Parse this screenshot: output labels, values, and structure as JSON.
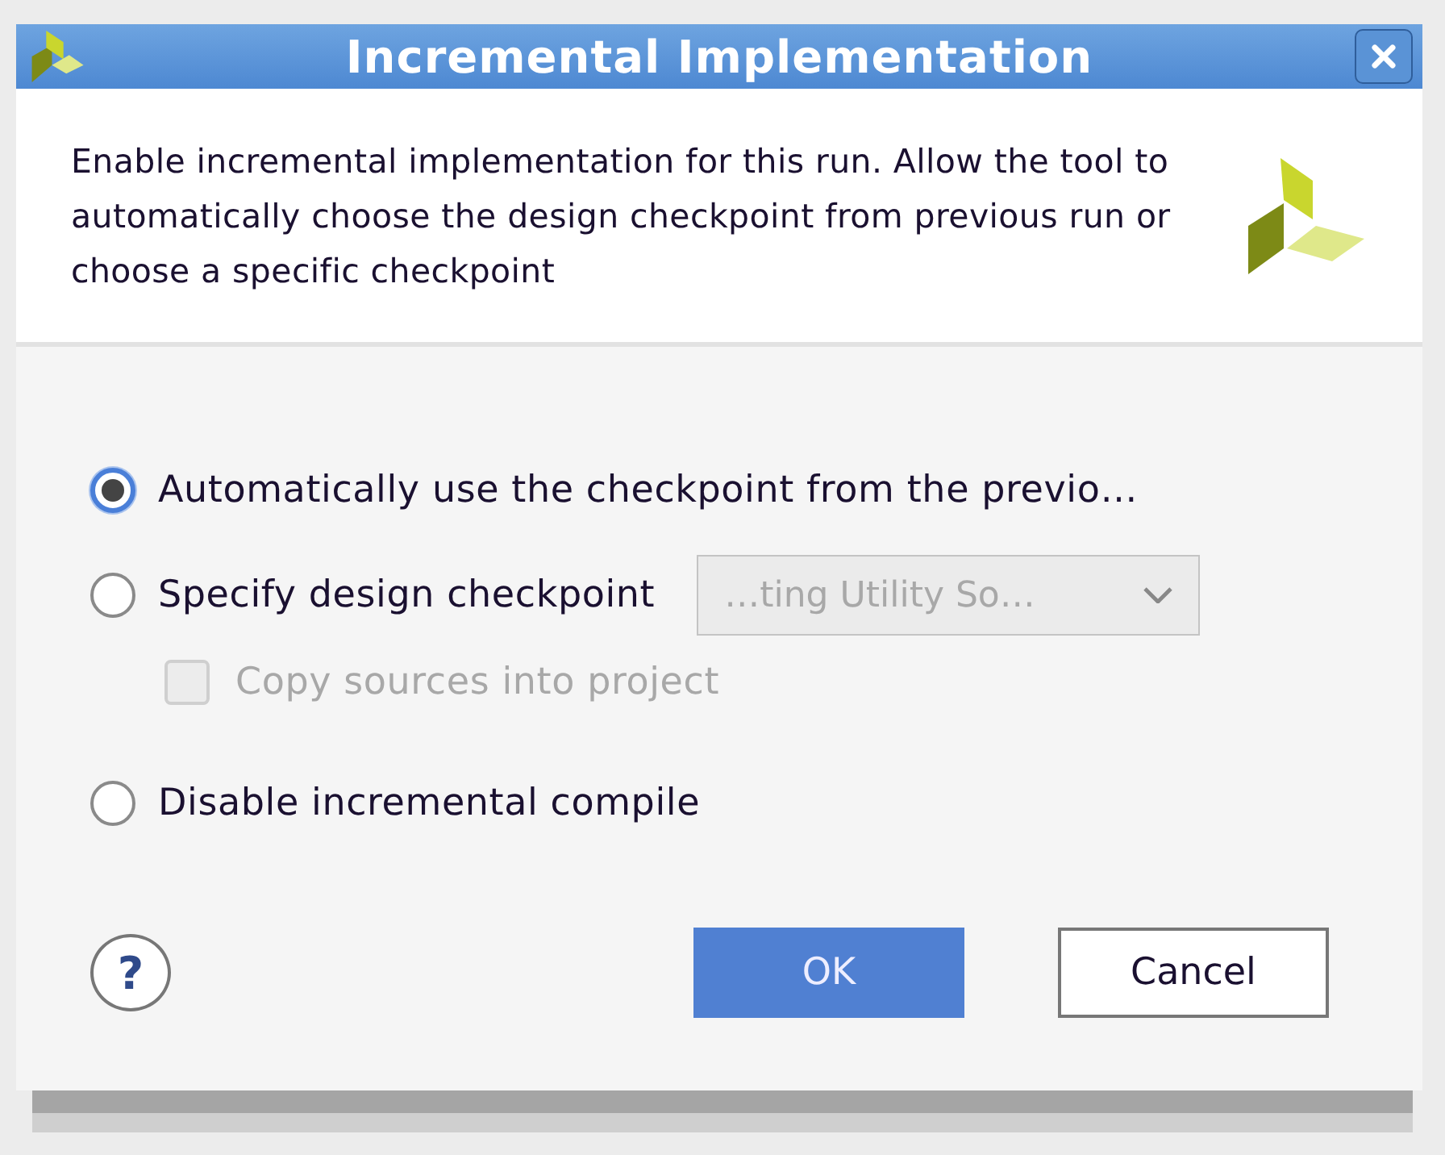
{
  "window": {
    "title": "Incremental Implementation"
  },
  "description": "Enable incremental implementation for this run. Allow the tool to automatically choose the design checkpoint from previous run or choose a specific checkpoint",
  "options": [
    {
      "kind": "radio",
      "label": "Automatically use the checkpoint from the previo…",
      "selected": true
    },
    {
      "kind": "radio",
      "label": "Specify design checkpoint",
      "selected": false,
      "dropdown": {
        "value": "…ting Utility So…",
        "disabled": true
      },
      "children": [
        {
          "kind": "checkbox",
          "label": "Copy sources into project",
          "checked": false,
          "disabled": true
        }
      ]
    },
    {
      "kind": "radio",
      "label": "Disable incremental compile",
      "selected": false
    }
  ],
  "help": {
    "label": "?"
  },
  "buttons": [
    {
      "label": "OK",
      "primary": true
    },
    {
      "label": "Cancel",
      "primary": false
    }
  ]
}
